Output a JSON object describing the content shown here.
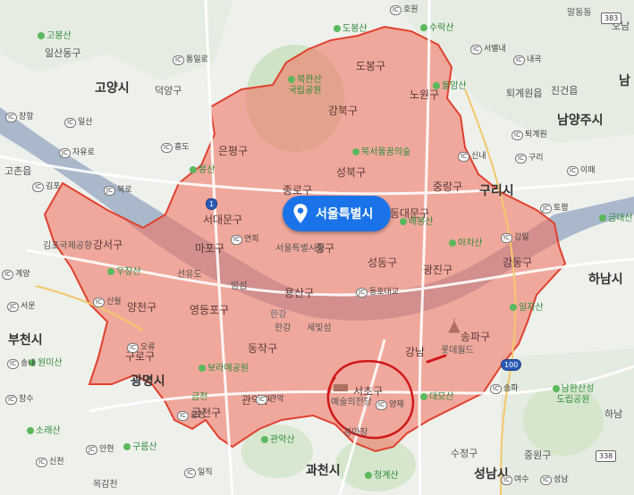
{
  "map": {
    "highlight": {
      "label": "서울특별시",
      "color": "#f26d5b"
    },
    "cities": [
      {
        "key": "goyang",
        "text": "고양시"
      },
      {
        "key": "guri",
        "text": "구리시"
      },
      {
        "key": "namyangju",
        "text": "남양주시"
      },
      {
        "key": "hanam",
        "text": "하남시"
      },
      {
        "key": "gwangmyeong",
        "text": "광명시"
      },
      {
        "key": "bucheon",
        "text": "부천시"
      },
      {
        "key": "gwacheon",
        "text": "과천시"
      },
      {
        "key": "seongnam",
        "text": "성남시"
      }
    ],
    "districts": [
      {
        "key": "dobong",
        "text": "도봉구"
      },
      {
        "key": "nowon",
        "text": "노원구"
      },
      {
        "key": "gangbuk",
        "text": "강북구"
      },
      {
        "key": "eunpyeong",
        "text": "은평구"
      },
      {
        "key": "seongbuk",
        "text": "성북구"
      },
      {
        "key": "jongno",
        "text": "종로구"
      },
      {
        "key": "jungnang",
        "text": "중랑구"
      },
      {
        "key": "seodaemun",
        "text": "서대문구"
      },
      {
        "key": "dongdaemun",
        "text": "동대문구"
      },
      {
        "key": "gangseo",
        "text": "강서구"
      },
      {
        "key": "mapo",
        "text": "마포구"
      },
      {
        "key": "junggu",
        "text": "중구"
      },
      {
        "key": "seongdong",
        "text": "성동구"
      },
      {
        "key": "gwangjin",
        "text": "광진구"
      },
      {
        "key": "gangdong",
        "text": "강동구"
      },
      {
        "key": "yangcheon",
        "text": "양천구"
      },
      {
        "key": "yeongdeungpo",
        "text": "영등포구"
      },
      {
        "key": "yongsan",
        "text": "용산구"
      },
      {
        "key": "guro",
        "text": "구로구"
      },
      {
        "key": "dongjak",
        "text": "동작구"
      },
      {
        "key": "gwanak",
        "text": "관악구"
      },
      {
        "key": "seocho",
        "text": "서초구"
      },
      {
        "key": "gangnam",
        "text": "강남"
      },
      {
        "key": "songpa",
        "text": "송파구"
      },
      {
        "key": "geumcheon",
        "text": "금천구"
      }
    ],
    "towns": [
      {
        "key": "ilsandong",
        "text": "일산동구"
      },
      {
        "key": "deogyang",
        "text": "덕양구"
      },
      {
        "key": "gochon",
        "text": "고촌읍"
      },
      {
        "key": "jingeon",
        "text": "진건읍"
      },
      {
        "key": "toegyewon",
        "text": "퇴계원읍"
      },
      {
        "key": "jungwon",
        "text": "중원구"
      },
      {
        "key": "sujeong",
        "text": "수정구"
      },
      {
        "key": "gimpo_airport",
        "text": "김포국제공항"
      },
      {
        "key": "seonyudo",
        "text": "선유도"
      },
      {
        "key": "bamseom",
        "text": "밤섬"
      },
      {
        "key": "hangang",
        "text": "한강"
      },
      {
        "key": "sebitseom",
        "text": "세빛섬"
      },
      {
        "key": "city_hall",
        "text": "서울특별시청"
      },
      {
        "key": "lotte_world",
        "text": "롯데월드"
      },
      {
        "key": "arts_center",
        "text": "예술의전당"
      },
      {
        "key": "racecourse",
        "text": "경마장"
      },
      {
        "key": "nam",
        "text": "남"
      },
      {
        "key": "o",
        "text": "오남"
      },
      {
        "key": "hanam_partial",
        "text": "하남"
      }
    ],
    "mountains": [
      {
        "key": "gobongsan",
        "text": "고봉산"
      },
      {
        "key": "dobongsan",
        "text": "도봉산"
      },
      {
        "key": "suraksan",
        "text": "수락산"
      },
      {
        "key": "bukhansan",
        "text": "북한산 국립공원"
      },
      {
        "key": "buramsan",
        "text": "불암산"
      },
      {
        "key": "bukseoul",
        "text": "북서울꿈의숲"
      },
      {
        "key": "bongsan",
        "text": "봉산"
      },
      {
        "key": "baebongsan",
        "text": "배봉산"
      },
      {
        "key": "achasan",
        "text": "아차산"
      },
      {
        "key": "geumdaesan",
        "text": "금대산"
      },
      {
        "key": "ujangsan",
        "text": "우장산"
      },
      {
        "key": "iljasan",
        "text": "일자산"
      },
      {
        "key": "wonmisan",
        "text": "원미산"
      },
      {
        "key": "boramae",
        "text": "보라매공원"
      },
      {
        "key": "daemosan",
        "text": "대모산"
      },
      {
        "key": "namhansanseong",
        "text": "남한산성 도립공원"
      },
      {
        "key": "soraesan",
        "text": "소래산"
      },
      {
        "key": "gwanaksan",
        "text": "관악산"
      },
      {
        "key": "gureumsan",
        "text": "구름산"
      },
      {
        "key": "cheonggyesan",
        "text": "청계산"
      },
      {
        "key": "geumtan",
        "text": "금천"
      }
    ],
    "interchanges": [
      {
        "key": "howon",
        "text": "호원"
      },
      {
        "key": "tongilro",
        "text": "통일로"
      },
      {
        "key": "jangang",
        "text": "장항"
      },
      {
        "key": "ilsan",
        "text": "일산"
      },
      {
        "key": "jayuro",
        "text": "자유로"
      },
      {
        "key": "heungdo",
        "text": "흥도"
      },
      {
        "key": "gimpo",
        "text": "김포"
      },
      {
        "key": "bukro",
        "text": "북로"
      },
      {
        "key": "gyeyang",
        "text": "계양"
      },
      {
        "key": "seoun",
        "text": "서운"
      },
      {
        "key": "sinwol",
        "text": "신월"
      },
      {
        "key": "ori",
        "text": "오류"
      },
      {
        "key": "songnae",
        "text": "송내"
      },
      {
        "key": "jangsu",
        "text": "장수"
      },
      {
        "key": "yeonhui",
        "text": "연희"
      },
      {
        "key": "dongho",
        "text": "동호대교"
      },
      {
        "key": "seobuk",
        "text": "서별내"
      },
      {
        "key": "naegok",
        "text": "내곡"
      },
      {
        "key": "toegye",
        "text": "퇴계원"
      },
      {
        "key": "sinnae",
        "text": "신내"
      },
      {
        "key": "guri",
        "text": "구리"
      },
      {
        "key": "idong",
        "text": "이패"
      },
      {
        "key": "topyeong",
        "text": "토평"
      },
      {
        "key": "gangil",
        "text": "강일"
      },
      {
        "key": "songpa_ic",
        "text": "송파"
      },
      {
        "key": "yangjae",
        "text": "양재"
      },
      {
        "key": "gwanak_ic",
        "text": "관악"
      },
      {
        "key": "geumcheon_ic",
        "text": "금천"
      },
      {
        "key": "anhyeon",
        "text": "안현"
      },
      {
        "key": "ilji",
        "text": "일직"
      },
      {
        "key": "sinhae",
        "text": "신천"
      },
      {
        "key": "yeoksam",
        "text": "여수"
      },
      {
        "key": "seongnam",
        "text": "성남"
      }
    ],
    "shields": [
      {
        "key": "r383",
        "text": "383"
      },
      {
        "key": "r338",
        "text": "338"
      },
      {
        "key": "r100",
        "text": "100"
      },
      {
        "key": "r1",
        "text": "1"
      }
    ],
    "extras": [
      {
        "key": "hangang_river",
        "text": "한강"
      },
      {
        "key": "mokgam",
        "text": "목감천"
      },
      {
        "key": "aldong",
        "text": "알동동"
      }
    ]
  }
}
